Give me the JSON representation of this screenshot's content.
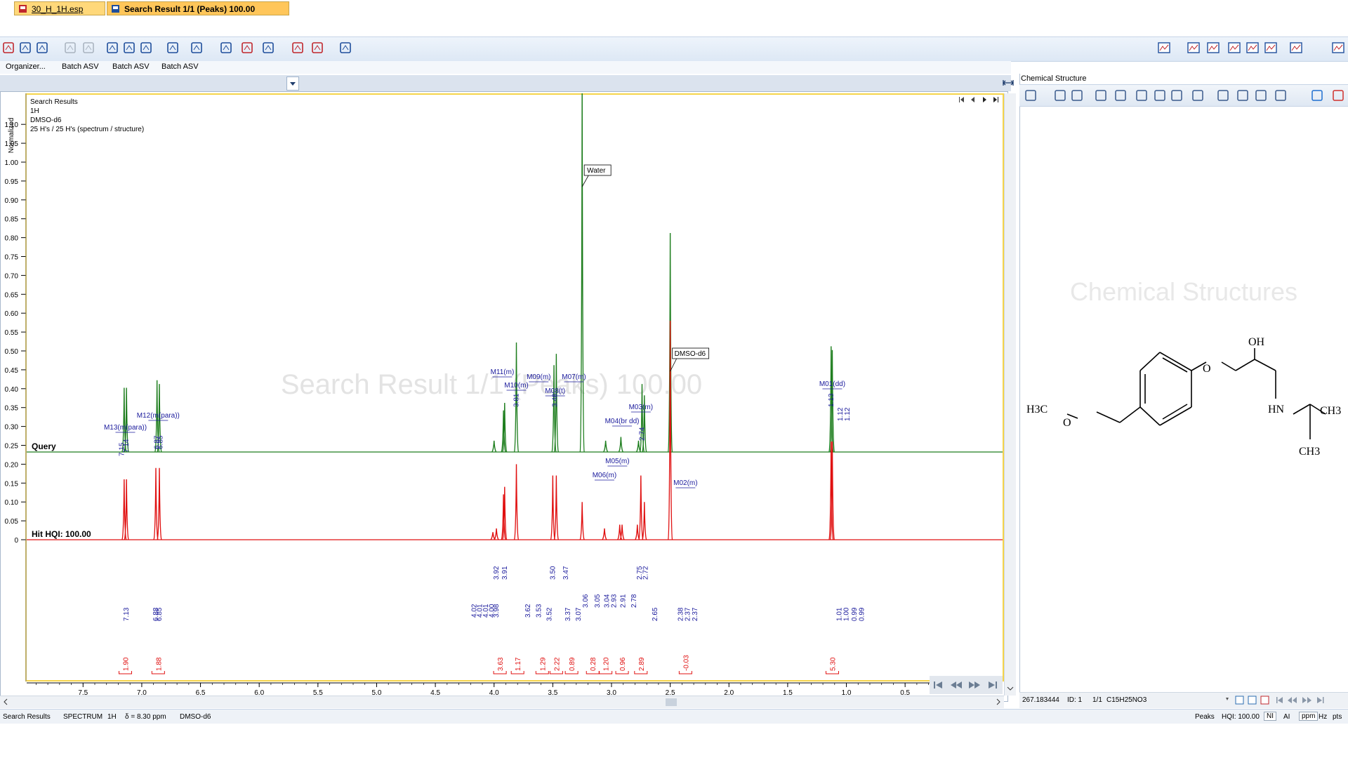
{
  "toolbar": {
    "icons": [
      "open-icon",
      "save-icon",
      "save-all-icon",
      "undo-icon",
      "redo-icon",
      "zoom-fit-icon",
      "zoom-in-icon",
      "zoom-region-icon",
      "zoom-out-icon",
      "display-options-icon",
      "view-layout-icon",
      "compare-icon",
      "print-icon",
      "peak-pick-icon",
      "integrate-icon",
      "assign-icon"
    ],
    "right_icons": [
      "layout-tile-icon",
      "spectrum-view-icon",
      "split-view-icon",
      "export-icon",
      "report-icon",
      "settings-icon",
      "window-icon",
      "window-close-icon"
    ]
  },
  "menubar": {
    "items": [
      "Organizer...",
      "Batch ASV",
      "Batch ASV",
      "Batch ASV"
    ]
  },
  "tabs": [
    {
      "label": "30_H_1H.esp",
      "active": false
    },
    {
      "label": "Search Result 1/1 (Peaks) 100.00",
      "active": true
    }
  ],
  "spectrum": {
    "info_lines": [
      "Search Results",
      "1H",
      "DMSO-d6",
      "25 H's / 25 H's (spectrum / structure)"
    ],
    "y_axis_label": "Normalized",
    "watermark": "Search Result 1/1 (Peaks) 100.00",
    "query_label": "Query",
    "hit_label": "Hit HQI: 100.00",
    "y_ticks": [
      "1.10",
      "1.05",
      "1.00",
      "0.95",
      "0.90",
      "0.85",
      "0.80",
      "0.75",
      "0.70",
      "0.65",
      "0.60",
      "0.55",
      "0.50",
      "0.45",
      "0.40",
      "0.35",
      "0.30",
      "0.25",
      "0.20",
      "0.15",
      "0.10",
      "0.05",
      "0"
    ],
    "x_ticks": [
      "7.5",
      "7.0",
      "6.5",
      "6.0",
      "5.5",
      "5.0",
      "4.5",
      "4.0",
      "3.5",
      "3.0",
      "2.5",
      "2.0",
      "1.5",
      "1.0",
      "0.5"
    ],
    "solvent_labels": [
      "Water",
      "DMSO-d6"
    ]
  },
  "chart_data": {
    "type": "line",
    "xlabel": "",
    "ylabel": "Normalized",
    "xlim": [
      7.98,
      -0.33
    ],
    "ylim": [
      -0.05,
      1.17
    ],
    "query_peaks": [
      {
        "ppm": 7.15,
        "h": 0.37
      },
      {
        "ppm": 7.13,
        "h": 0.37
      },
      {
        "ppm": 6.87,
        "h": 0.39
      },
      {
        "ppm": 6.85,
        "h": 0.38
      },
      {
        "ppm": 4.0,
        "h": 0.23
      },
      {
        "ppm": 3.92,
        "h": 0.31
      },
      {
        "ppm": 3.91,
        "h": 0.33
      },
      {
        "ppm": 3.81,
        "h": 0.49
      },
      {
        "ppm": 3.49,
        "h": 0.43
      },
      {
        "ppm": 3.47,
        "h": 0.46
      },
      {
        "ppm": 3.25,
        "h": 1.2
      },
      {
        "ppm": 3.05,
        "h": 0.23
      },
      {
        "ppm": 2.92,
        "h": 0.24
      },
      {
        "ppm": 2.77,
        "h": 0.23
      },
      {
        "ppm": 2.74,
        "h": 0.38
      },
      {
        "ppm": 2.72,
        "h": 0.35
      },
      {
        "ppm": 2.5,
        "h": 0.78
      },
      {
        "ppm": 1.13,
        "h": 0.48
      },
      {
        "ppm": 1.12,
        "h": 0.47
      }
    ],
    "hit_peaks": [
      {
        "ppm": 7.15,
        "h": 0.16
      },
      {
        "ppm": 7.13,
        "h": 0.16
      },
      {
        "ppm": 6.88,
        "h": 0.19
      },
      {
        "ppm": 6.85,
        "h": 0.19
      },
      {
        "ppm": 4.01,
        "h": 0.02
      },
      {
        "ppm": 3.98,
        "h": 0.03
      },
      {
        "ppm": 3.92,
        "h": 0.12
      },
      {
        "ppm": 3.91,
        "h": 0.14
      },
      {
        "ppm": 3.81,
        "h": 0.2
      },
      {
        "ppm": 3.5,
        "h": 0.17
      },
      {
        "ppm": 3.47,
        "h": 0.17
      },
      {
        "ppm": 3.25,
        "h": 0.1
      },
      {
        "ppm": 3.06,
        "h": 0.03
      },
      {
        "ppm": 2.93,
        "h": 0.04
      },
      {
        "ppm": 2.91,
        "h": 0.04
      },
      {
        "ppm": 2.78,
        "h": 0.04
      },
      {
        "ppm": 2.75,
        "h": 0.17
      },
      {
        "ppm": 2.72,
        "h": 0.1
      },
      {
        "ppm": 2.5,
        "h": 0.58
      },
      {
        "ppm": 1.13,
        "h": 0.26
      },
      {
        "ppm": 1.12,
        "h": 0.26
      }
    ],
    "multiplets": [
      {
        "label": "M13(m(para))",
        "ppm": 7.14
      },
      {
        "label": "M12(m(para))",
        "ppm": 6.86
      },
      {
        "label": "M11(m)",
        "ppm": 3.93
      },
      {
        "label": "M10(m)",
        "ppm": 3.81
      },
      {
        "label": "M09(m)",
        "ppm": 3.62
      },
      {
        "label": "M08(t)",
        "ppm": 3.48
      },
      {
        "label": "M07(m)",
        "ppm": 3.32
      },
      {
        "label": "M06(m)",
        "ppm": 3.06
      },
      {
        "label": "M05(m)",
        "ppm": 2.95
      },
      {
        "label": "M04(br dd)",
        "ppm": 2.91
      },
      {
        "label": "M03(m)",
        "ppm": 2.75
      },
      {
        "label": "M02(m)",
        "ppm": 2.37
      },
      {
        "label": "M01(dd)",
        "ppm": 1.12
      }
    ],
    "query_shift_labels": [
      {
        "t": "7.15",
        "ppm": 7.17
      },
      {
        "t": "7.14",
        "ppm": 7.13
      },
      {
        "t": "6.87",
        "ppm": 6.87
      },
      {
        "t": "6.85",
        "ppm": 6.84
      },
      {
        "t": "3.81",
        "ppm": 3.81
      },
      {
        "t": "3.48",
        "ppm": 3.48
      },
      {
        "t": "2.74",
        "ppm": 2.74
      },
      {
        "t": "1.13",
        "ppm": 1.13
      },
      {
        "t": "1.12",
        "ppm": 1.05
      },
      {
        "t": "1.12",
        "ppm": 0.99
      }
    ],
    "hit_shift_labels": [
      {
        "t": "7.13",
        "ppm": 7.13
      },
      {
        "t": "6.88",
        "ppm": 6.88
      },
      {
        "t": "6.85",
        "ppm": 6.85
      },
      {
        "t": "4.02",
        "ppm": 4.17
      },
      {
        "t": "4.01",
        "ppm": 4.12
      },
      {
        "t": "4.01",
        "ppm": 4.07
      },
      {
        "t": "4.00",
        "ppm": 4.02
      },
      {
        "t": "3.98",
        "ppm": 3.98
      },
      {
        "t": "3.92",
        "ppm": 3.98
      },
      {
        "t": "3.91",
        "ppm": 3.91
      },
      {
        "t": "3.62",
        "ppm": 3.71
      },
      {
        "t": "3.53",
        "ppm": 3.62
      },
      {
        "t": "3.52",
        "ppm": 3.53
      },
      {
        "t": "3.50",
        "ppm": 3.5
      },
      {
        "t": "3.47",
        "ppm": 3.39
      },
      {
        "t": "3.37",
        "ppm": 3.37
      },
      {
        "t": "3.07",
        "ppm": 3.28
      },
      {
        "t": "3.06",
        "ppm": 3.22
      },
      {
        "t": "3.05",
        "ppm": 3.12
      },
      {
        "t": "3.04",
        "ppm": 3.04
      },
      {
        "t": "2.93",
        "ppm": 2.98
      },
      {
        "t": "2.91",
        "ppm": 2.9
      },
      {
        "t": "2.78",
        "ppm": 2.81
      },
      {
        "t": "2.75",
        "ppm": 2.76
      },
      {
        "t": "2.72",
        "ppm": 2.71
      },
      {
        "t": "2.65",
        "ppm": 2.63
      },
      {
        "t": "2.38",
        "ppm": 2.41
      },
      {
        "t": "2.37",
        "ppm": 2.35
      },
      {
        "t": "2.37",
        "ppm": 2.29
      },
      {
        "t": "1.01",
        "ppm": 1.06
      },
      {
        "t": "1.00",
        "ppm": 1.0
      },
      {
        "t": "0.99",
        "ppm": 0.93
      },
      {
        "t": "0.99",
        "ppm": 0.87
      }
    ],
    "integrals": [
      {
        "t": "1.90",
        "ppm": 7.14
      },
      {
        "t": "1.88",
        "ppm": 6.86
      },
      {
        "t": "3.63",
        "ppm": 3.95
      },
      {
        "t": "1.17",
        "ppm": 3.8
      },
      {
        "t": "1.29",
        "ppm": 3.59
      },
      {
        "t": "2.22",
        "ppm": 3.47
      },
      {
        "t": "0.89",
        "ppm": 3.34
      },
      {
        "t": "0.28",
        "ppm": 3.16
      },
      {
        "t": "1.20",
        "ppm": 3.05
      },
      {
        "t": "0.96",
        "ppm": 2.91
      },
      {
        "t": "2.89",
        "ppm": 2.75
      },
      {
        "t": "-0.03",
        "ppm": 2.37
      },
      {
        "t": "5.30",
        "ppm": 1.12
      }
    ]
  },
  "chemical_structure": {
    "panel_title": "Chemical Structure",
    "watermark": "Chemical Structures",
    "atoms": [
      "H3C",
      "O",
      "O",
      "OH",
      "HN",
      "CH3",
      "CH3"
    ],
    "bottom_bar": {
      "mass": "267.183444",
      "id": "ID: 1",
      "page": "1/1",
      "formula": "C15H25NO3"
    }
  },
  "status_bar": {
    "items": [
      "Search Results",
      "SPECTRUM",
      "1H",
      "δ = 8.30 ppm",
      "DMSO-d6"
    ],
    "right_items": [
      "Peaks",
      "HQI: 100.00",
      "NI",
      "AI",
      "ppm",
      "Hz",
      "pts"
    ]
  },
  "colors": {
    "query": "#1e7e1e",
    "hit": "#e01010",
    "label": "#1a1a9c",
    "tab_active": "#ffc65a",
    "frame": "#f5d44a"
  }
}
